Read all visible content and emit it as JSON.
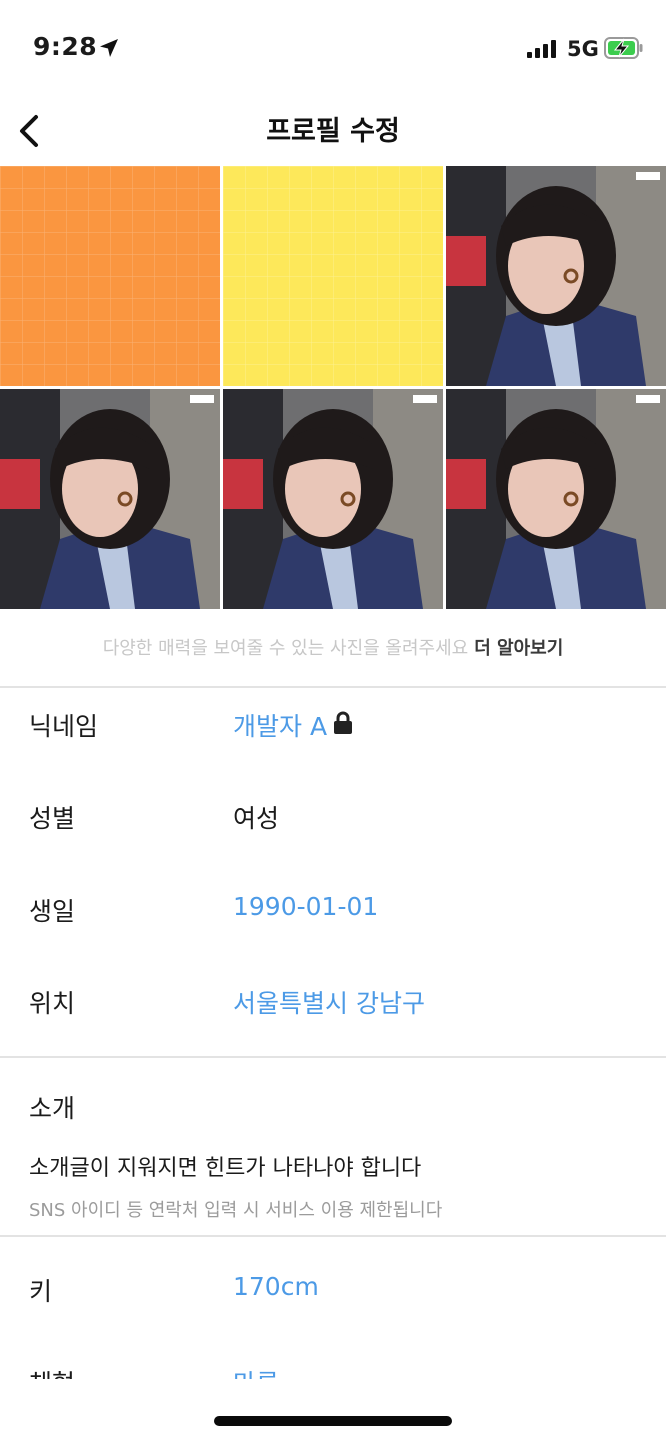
{
  "status": {
    "time": "9:28",
    "network": "5G"
  },
  "nav": {
    "title": "프로필 수정"
  },
  "photos": {
    "cells": [
      "orange-grid",
      "yellow-grid",
      "photo",
      "photo",
      "photo",
      "photo"
    ],
    "hint": "다양한 매력을 보여줄 수 있는 사진을 올려주세요",
    "learn_more": "더 알아보기"
  },
  "profile": {
    "nickname": {
      "label": "닉네임",
      "value": "개발자 A"
    },
    "gender": {
      "label": "성별",
      "value": "여성"
    },
    "birthday": {
      "label": "생일",
      "value": "1990-01-01"
    },
    "location": {
      "label": "위치",
      "value": "서울특별시 강남구"
    }
  },
  "intro": {
    "label": "소개",
    "text": "소개글이 지워지면 힌트가 나타나야 합니다",
    "notice": "SNS 아이디 등 연락처 입력 시 서비스 이용 제한됩니다"
  },
  "details": {
    "height": {
      "label": "키",
      "value": "170cm"
    },
    "body": {
      "label": "체형",
      "value": "마른"
    }
  },
  "colors": {
    "accent": "#4c9ae6",
    "orange": "#fa9640",
    "yellow": "#fde85a"
  }
}
